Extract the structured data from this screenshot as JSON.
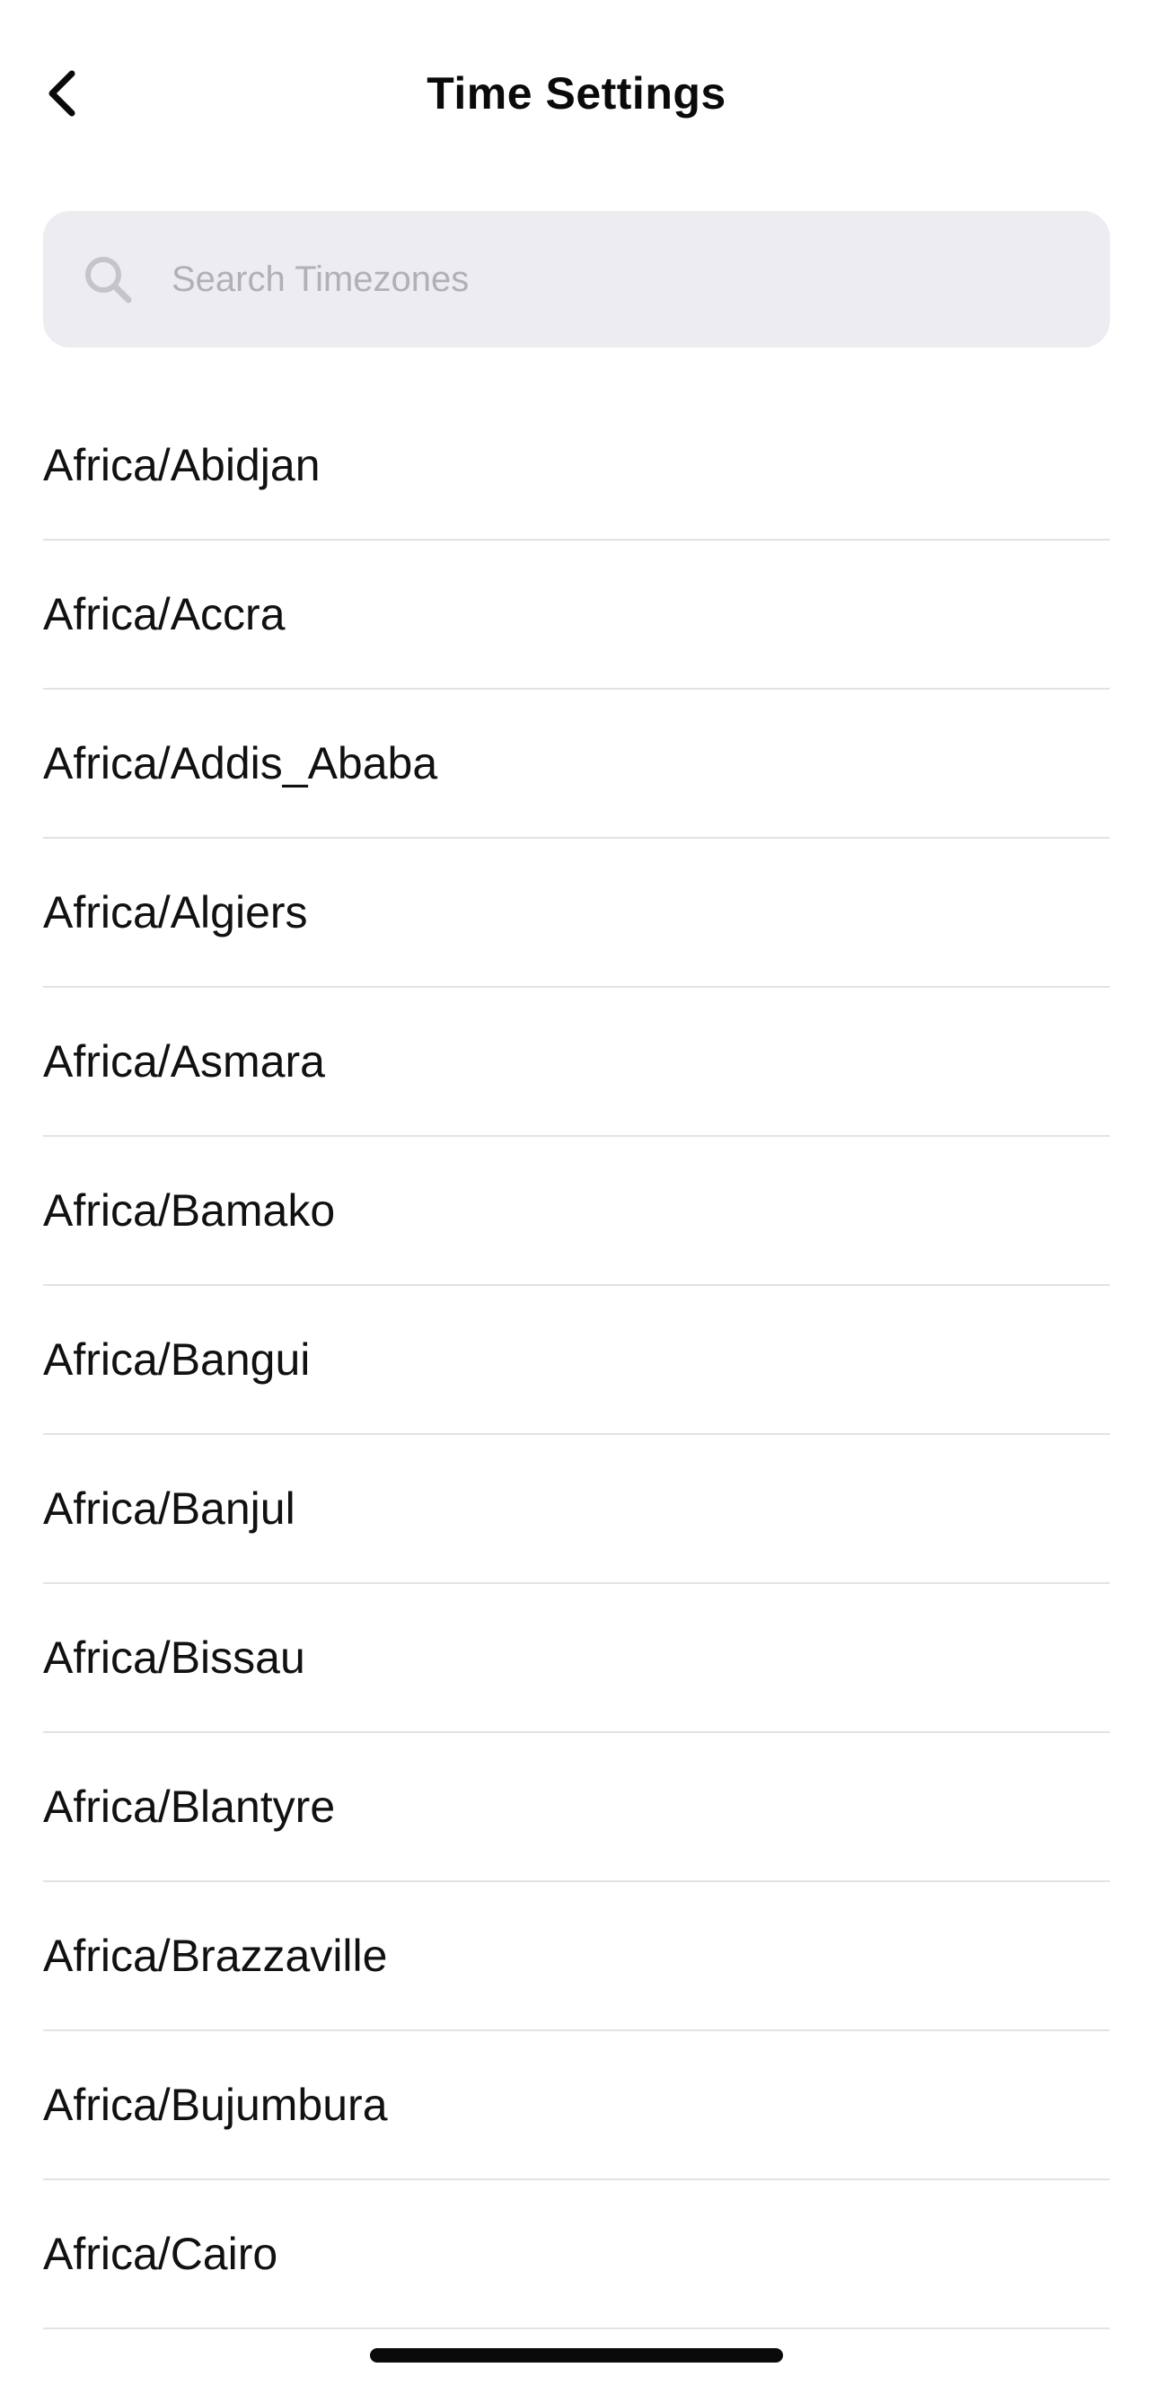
{
  "header": {
    "title": "Time Settings",
    "back_icon": "chevron-left-icon"
  },
  "search": {
    "placeholder": "Search Timezones",
    "value": "",
    "icon": "search-icon"
  },
  "timezones": [
    "Africa/Abidjan",
    "Africa/Accra",
    "Africa/Addis_Ababa",
    "Africa/Algiers",
    "Africa/Asmara",
    "Africa/Bamako",
    "Africa/Bangui",
    "Africa/Banjul",
    "Africa/Bissau",
    "Africa/Blantyre",
    "Africa/Brazzaville",
    "Africa/Bujumbura",
    "Africa/Cairo"
  ],
  "colors": {
    "search_background": "#ececf1",
    "placeholder": "#b0b0b6",
    "divider": "#e3e3e6",
    "text": "#111111"
  }
}
